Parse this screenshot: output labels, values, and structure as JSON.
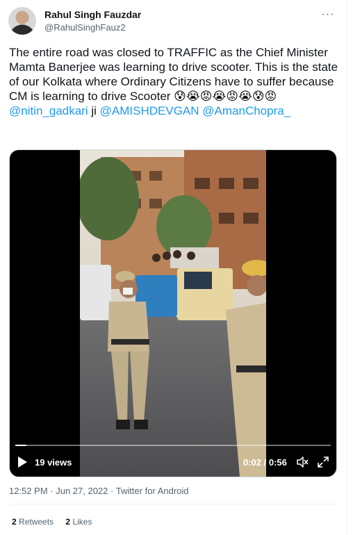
{
  "user": {
    "name": "Rahul Singh Fauzdar",
    "handle": "@RahulSinghFauz2"
  },
  "tweet": {
    "text": "The entire road was closed to TRAFFIC as the Chief Minister Mamta Banerjee was learning to drive scooter. This is the state of our Kolkata where Ordinary Citizens have to suffer because CM is learning to drive Scooter",
    "emojis": "😰😭😡😭😡😭😰😡",
    "mention1": "@nitin_gadkari",
    "joiner": " ji ",
    "mention2": "@AMISHDEVGAN",
    "mention3": "@AmanChopra_"
  },
  "video": {
    "views": "19 views",
    "time": "0:02 / 0:56",
    "progress": 0.036
  },
  "meta": {
    "time": "12:52 PM",
    "sep1": " · ",
    "date": "Jun 27, 2022",
    "sep2": " · ",
    "source": "Twitter for Android"
  },
  "stats": {
    "retweets_count": "2",
    "retweets_label": "Retweets",
    "likes_count": "2",
    "likes_label": "Likes"
  }
}
